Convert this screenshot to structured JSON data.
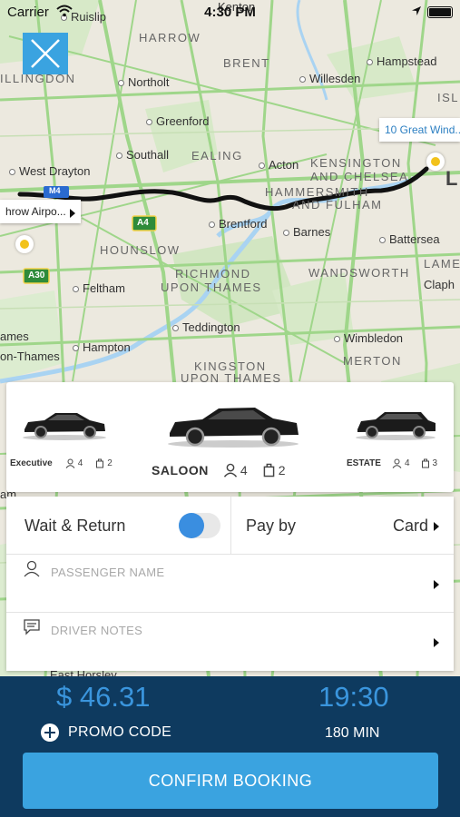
{
  "status_bar": {
    "carrier": "Carrier",
    "time": "4:30 PM"
  },
  "map": {
    "places": [
      {
        "id": "ruislip",
        "label": "Ruislip",
        "big": false
      },
      {
        "id": "harrow",
        "label": "HARROW",
        "big": true
      },
      {
        "id": "kenton",
        "label": "Kenton",
        "big": false
      },
      {
        "id": "brent",
        "label": "BRENT",
        "big": true
      },
      {
        "id": "hampstead",
        "label": "Hampstead",
        "big": false
      },
      {
        "id": "hillingdon",
        "label": "ILLINGDON",
        "big": true
      },
      {
        "id": "northolt",
        "label": "Northolt",
        "big": false
      },
      {
        "id": "willesden",
        "label": "Willesden",
        "big": false
      },
      {
        "id": "isl",
        "label": "ISL",
        "big": true
      },
      {
        "id": "greenford",
        "label": "Greenford",
        "big": false
      },
      {
        "id": "southall",
        "label": "Southall",
        "big": false
      },
      {
        "id": "ealing",
        "label": "EALING",
        "big": true
      },
      {
        "id": "acton",
        "label": "Acton",
        "big": false
      },
      {
        "id": "kensington",
        "label": "KENSINGTON",
        "big": true
      },
      {
        "id": "chelsea",
        "label": "AND CHELSEA",
        "big": true
      },
      {
        "id": "westdrayton",
        "label": "West Drayton",
        "big": false
      },
      {
        "id": "hammersmith",
        "label": "HAMMERSMITH",
        "big": true
      },
      {
        "id": "fulham",
        "label": "AND FULHAM",
        "big": true
      },
      {
        "id": "brentford",
        "label": "Brentford",
        "big": false
      },
      {
        "id": "barnes",
        "label": "Barnes",
        "big": false
      },
      {
        "id": "battersea",
        "label": "Battersea",
        "big": false
      },
      {
        "id": "hounslow",
        "label": "HOUNSLOW",
        "big": true
      },
      {
        "id": "lame",
        "label": "LAME",
        "big": true
      },
      {
        "id": "richmond",
        "label": "RICHMOND",
        "big": true
      },
      {
        "id": "upon",
        "label": "UPON THAMES",
        "big": true
      },
      {
        "id": "wandsworth",
        "label": "WANDSWORTH",
        "big": true
      },
      {
        "id": "feltham",
        "label": "Feltham",
        "big": false
      },
      {
        "id": "clap",
        "label": "Claph",
        "big": false
      },
      {
        "id": "teddington",
        "label": "Teddington",
        "big": false
      },
      {
        "id": "ames",
        "label": "ames",
        "big": false
      },
      {
        "id": "wimbledon",
        "label": "Wimbledon",
        "big": false
      },
      {
        "id": "hampton",
        "label": "Hampton",
        "big": false
      },
      {
        "id": "onthames",
        "label": "on-Thames",
        "big": false
      },
      {
        "id": "merton",
        "label": "MERTON",
        "big": true
      },
      {
        "id": "kingston",
        "label": "KINGSTON",
        "big": true
      },
      {
        "id": "kupon",
        "label": "UPON THAMES",
        "big": true
      },
      {
        "id": "am",
        "label": "am",
        "big": false
      },
      {
        "id": "easthorsley",
        "label": "East Horsley",
        "big": false
      }
    ],
    "road_labels": {
      "a4": "A4",
      "a30": "A30",
      "m4": "M4"
    },
    "dest_label": "10 Great Wind...",
    "dest_letter": "L",
    "origin_label": "hrow Airpo..."
  },
  "vehicles": [
    {
      "name": "Executive",
      "passengers": "4",
      "luggage": "2"
    },
    {
      "name": "SALOON",
      "passengers": "4",
      "luggage": "2"
    },
    {
      "name": "ESTATE",
      "passengers": "4",
      "luggage": "3"
    }
  ],
  "options": {
    "wait_return_label": "Wait & Return",
    "wait_return_on": true,
    "pay_by_label": "Pay by",
    "pay_method": "Card",
    "passenger_placeholder": "PASSENGER NAME",
    "driver_notes_placeholder": "DRIVER NOTES"
  },
  "summary": {
    "price": "$ 46.31",
    "time": "19:30",
    "promo_label": "PROMO CODE",
    "duration": "180 MIN",
    "confirm_label": "CONFIRM BOOKING"
  },
  "colors": {
    "accent": "#3aa3e0",
    "bottom_bg": "#0e3a5f",
    "route": "#111111",
    "pin": "#f2c21b"
  }
}
